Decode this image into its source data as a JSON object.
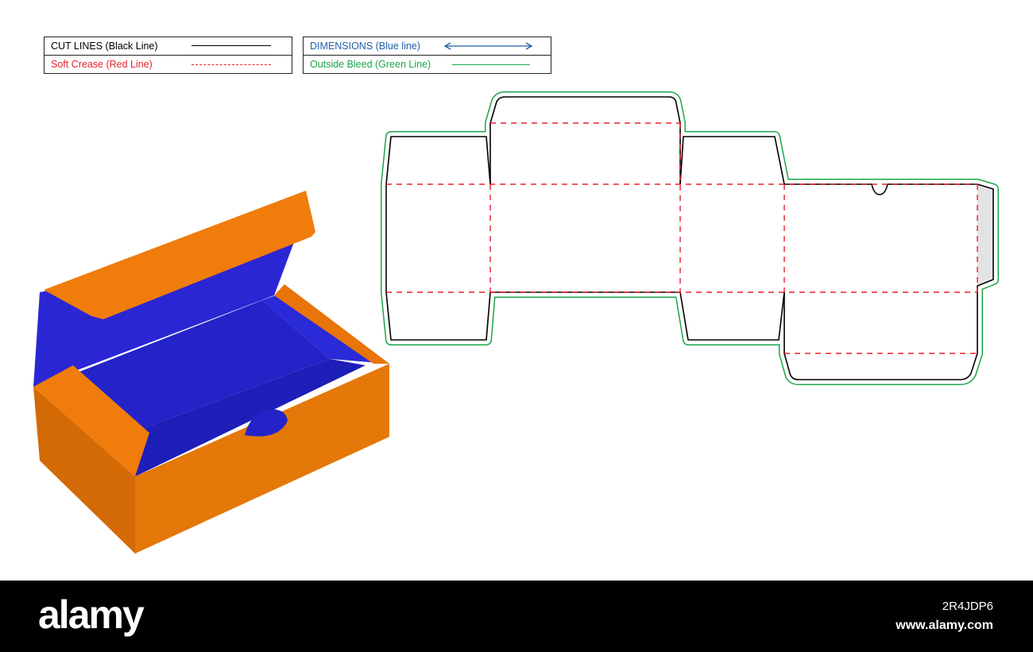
{
  "legend_left": {
    "cut_lines": "CUT LINES (Black Line)",
    "soft_crease": "Soft Crease (Red Line)"
  },
  "legend_right": {
    "dimensions": "DIMENSIONS (Blue line)",
    "outside_bleed": "Outside Bleed (Green Line)"
  },
  "colors": {
    "cut": "#000000",
    "crease": "#e8202a",
    "dimension": "#1f5fa8",
    "bleed": "#1aa54a",
    "box_orange": "#f07c0c",
    "box_blue": "#2a26d4"
  },
  "footer": {
    "logo": "alamy",
    "image_code": "2R4JDP6",
    "url": "www.alamy.com"
  }
}
